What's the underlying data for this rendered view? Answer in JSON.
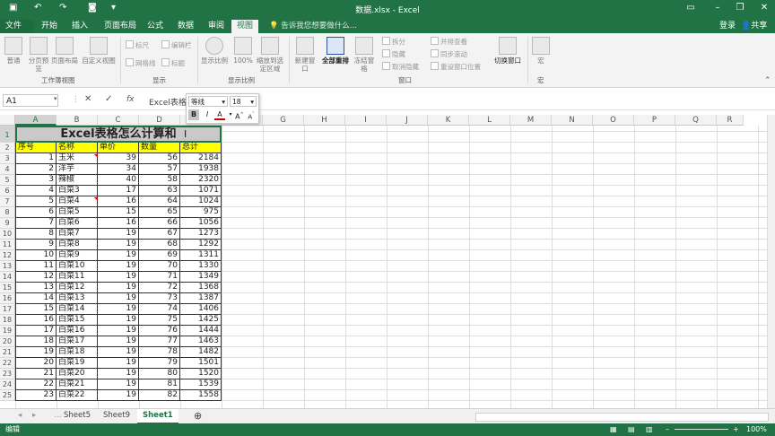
{
  "app": {
    "window_title": "数据.xlsx - Excel",
    "tabs": [
      "文件",
      "开始",
      "插入",
      "页面布局",
      "公式",
      "数据",
      "审阅",
      "视图"
    ],
    "active_tab": "视图",
    "tell_me": "告诉我您想要做什么...",
    "login": "登录",
    "share": "共享"
  },
  "ribbon": {
    "workbook_views": {
      "normal": "普通",
      "page_break": "分页预览",
      "page_layout": "页面布局",
      "custom_views": "自定义视图",
      "group": "工作簿视图"
    },
    "show": {
      "ruler": "标尺",
      "formula_bar": "编辑栏",
      "gridlines": "网格线",
      "headings": "标题",
      "group": "显示"
    },
    "zoom": {
      "zoom": "显示比例",
      "zoom100": "100%",
      "zoom_selection": "缩放到选定区域",
      "group": "显示比例"
    },
    "window": {
      "new_window": "新建窗口",
      "arrange_all": "全部重排",
      "freeze": "冻结窗格",
      "split": "拆分",
      "hide": "隐藏",
      "unhide": "取消隐藏",
      "side_by_side": "并排查看",
      "sync_scroll": "同步滚动",
      "reset_position": "重设窗口位置",
      "switch": "切换窗口",
      "group": "窗口"
    },
    "macros": {
      "macros": "宏",
      "group": "宏"
    }
  },
  "formula_bar": {
    "name_box": "A1",
    "cancel": "✕",
    "enter": "✓",
    "fx": "fx",
    "content": "Excel表格"
  },
  "mini_toolbar": {
    "font": "等线",
    "size": "18",
    "bold": "B",
    "italic": "I",
    "font_color": "A",
    "grow": "A",
    "shrink": "A"
  },
  "columns": [
    "A",
    "B",
    "C",
    "D",
    "E",
    "F",
    "G",
    "H",
    "I",
    "J",
    "K",
    "L",
    "M",
    "N",
    "O",
    "P",
    "Q",
    "R"
  ],
  "rows": [
    "1",
    "2",
    "3",
    "4",
    "5",
    "6",
    "7",
    "8",
    "9",
    "10",
    "11",
    "12",
    "13",
    "14",
    "15",
    "16",
    "17",
    "18",
    "19",
    "20",
    "21",
    "22",
    "23",
    "24",
    "25"
  ],
  "sheet": {
    "title": "Excel表格怎么计算和",
    "headers": [
      "序号",
      "名称",
      "单价",
      "数量",
      "总计"
    ],
    "data": [
      [
        "1",
        "玉米",
        "39",
        "56",
        "2184"
      ],
      [
        "2",
        "洋芋",
        "34",
        "57",
        "1938"
      ],
      [
        "3",
        "辣椒",
        "40",
        "58",
        "2320"
      ],
      [
        "4",
        "白菜3",
        "17",
        "63",
        "1071"
      ],
      [
        "5",
        "白菜4",
        "16",
        "64",
        "1024"
      ],
      [
        "6",
        "白菜5",
        "15",
        "65",
        "975"
      ],
      [
        "7",
        "白菜6",
        "16",
        "66",
        "1056"
      ],
      [
        "8",
        "白菜7",
        "19",
        "67",
        "1273"
      ],
      [
        "9",
        "白菜8",
        "19",
        "68",
        "1292"
      ],
      [
        "10",
        "白菜9",
        "19",
        "69",
        "1311"
      ],
      [
        "11",
        "白菜10",
        "19",
        "70",
        "1330"
      ],
      [
        "12",
        "白菜11",
        "19",
        "71",
        "1349"
      ],
      [
        "13",
        "白菜12",
        "19",
        "72",
        "1368"
      ],
      [
        "14",
        "白菜13",
        "19",
        "73",
        "1387"
      ],
      [
        "15",
        "白菜14",
        "19",
        "74",
        "1406"
      ],
      [
        "16",
        "白菜15",
        "19",
        "75",
        "1425"
      ],
      [
        "17",
        "白菜16",
        "19",
        "76",
        "1444"
      ],
      [
        "18",
        "白菜17",
        "19",
        "77",
        "1463"
      ],
      [
        "19",
        "白菜18",
        "19",
        "78",
        "1482"
      ],
      [
        "20",
        "白菜19",
        "19",
        "79",
        "1501"
      ],
      [
        "21",
        "白菜20",
        "19",
        "80",
        "1520"
      ],
      [
        "22",
        "白菜21",
        "19",
        "81",
        "1539"
      ],
      [
        "23",
        "白菜22",
        "19",
        "82",
        "1558"
      ]
    ]
  },
  "sheet_tabs": [
    "Sheet5",
    "Sheet9",
    "Sheet1"
  ],
  "active_sheet": "Sheet1",
  "status": {
    "mode": "编辑",
    "zoom": "100%"
  },
  "colors": {
    "excel_green": "#217346",
    "header_yellow": "#ffff00",
    "title_gray": "#c9c9c9"
  }
}
